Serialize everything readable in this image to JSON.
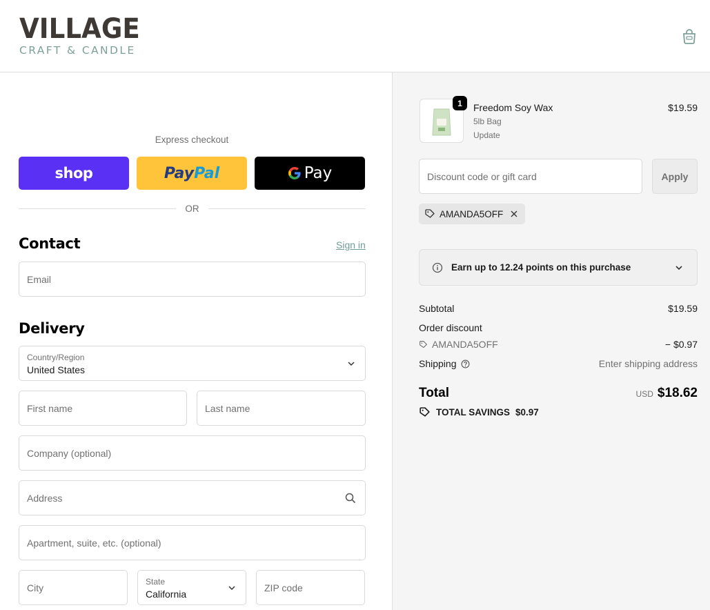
{
  "brand": {
    "name": "VILLAGE",
    "tagline": "CRAFT & CANDLE"
  },
  "express": {
    "label": "Express checkout",
    "shop_label": "shop",
    "paypal_part1": "Pay",
    "paypal_part2": "Pal",
    "gpay_label": "Pay",
    "or_label": "OR"
  },
  "contact": {
    "heading": "Contact",
    "signin": "Sign in",
    "email_placeholder": "Email"
  },
  "delivery": {
    "heading": "Delivery",
    "country_label": "Country/Region",
    "country_value": "United States",
    "first_name": "First name",
    "last_name": "Last name",
    "company": "Company (optional)",
    "address": "Address",
    "apartment": "Apartment, suite, etc. (optional)",
    "city": "City",
    "state_label": "State",
    "state_value": "California",
    "zip": "ZIP code"
  },
  "cart": {
    "item": {
      "quantity": "1",
      "name": "Freedom Soy Wax",
      "variant": "5lb Bag",
      "update": "Update",
      "price": "$19.59"
    },
    "discount_placeholder": "Discount code or gift card",
    "apply": "Apply",
    "applied_code": "AMANDA5OFF",
    "points_text": "Earn up to 12.24 points on this purchase",
    "subtotal_label": "Subtotal",
    "subtotal_value": "$19.59",
    "order_discount_label": "Order discount",
    "discount_code": "AMANDA5OFF",
    "discount_value": "− $0.97",
    "shipping_label": "Shipping",
    "shipping_value": "Enter shipping address",
    "total_label": "Total",
    "currency": "USD",
    "total_value": "$18.62",
    "savings_label": "TOTAL SAVINGS",
    "savings_value": "$0.97"
  },
  "colors": {
    "shop": "#5a31f4",
    "paypal": "#ffc439",
    "gpay": "#000000",
    "accent_link": "#6f9d96"
  }
}
